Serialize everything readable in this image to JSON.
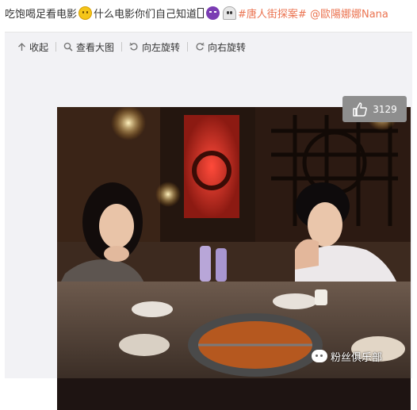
{
  "post": {
    "text_part1": "吃饱喝足看电影",
    "text_part2": "什么电影你们自己知道",
    "hashtag": "#唐人街探案#",
    "mention": "@歐陽娜娜Nana"
  },
  "toolbar": {
    "collapse": "收起",
    "view_large": "查看大图",
    "rotate_left": "向左旋转",
    "rotate_right": "向右旋转"
  },
  "like": {
    "count": "3129"
  },
  "watermark": {
    "text": "粉丝俱乐部"
  },
  "colors": {
    "link": "#eb7350",
    "panel": "#f2f2f5",
    "like_bg": "#8e8e8e"
  }
}
